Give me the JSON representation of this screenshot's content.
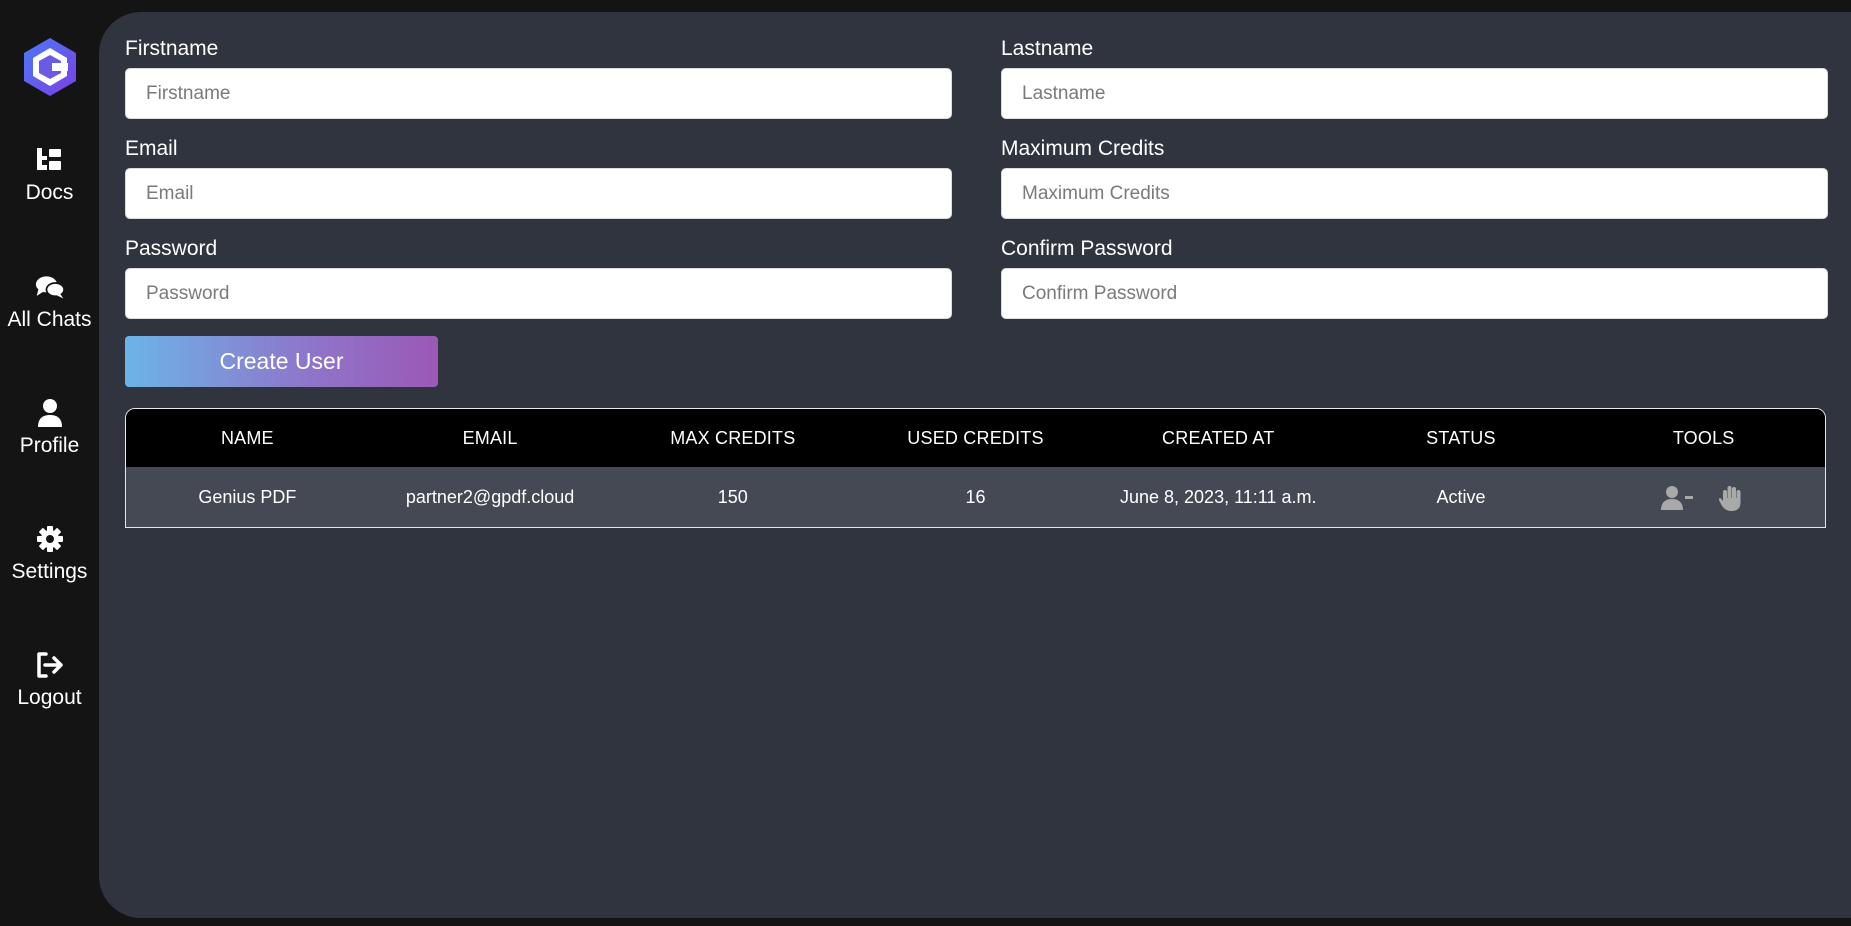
{
  "sidebar": {
    "logo_icon": "logo-icon",
    "items": [
      {
        "label": "Docs",
        "icon": "docs-icon"
      },
      {
        "label": "All Chats",
        "icon": "chats-icon"
      },
      {
        "label": "Profile",
        "icon": "user-icon"
      },
      {
        "label": "Settings",
        "icon": "gear-icon"
      },
      {
        "label": "Logout",
        "icon": "logout-icon"
      }
    ]
  },
  "form": {
    "firstname": {
      "label": "Firstname",
      "placeholder": "Firstname",
      "value": ""
    },
    "lastname": {
      "label": "Lastname",
      "placeholder": "Lastname",
      "value": ""
    },
    "email": {
      "label": "Email",
      "placeholder": "Email",
      "value": ""
    },
    "max_credits": {
      "label": "Maximum Credits",
      "placeholder": "Maximum Credits",
      "value": ""
    },
    "password": {
      "label": "Password",
      "placeholder": "Password",
      "value": ""
    },
    "confirm_password": {
      "label": "Confirm Password",
      "placeholder": "Confirm Password",
      "value": ""
    },
    "submit_label": "Create User"
  },
  "table": {
    "headers": [
      "NAME",
      "EMAIL",
      "MAX CREDITS",
      "USED CREDITS",
      "CREATED AT",
      "STATUS",
      "TOOLS"
    ],
    "rows": [
      {
        "name": "Genius PDF",
        "email": "partner2@gpdf.cloud",
        "max_credits": "150",
        "used_credits": "16",
        "created_at": "June 8, 2023, 11:11 a.m.",
        "status": "Active",
        "tools": [
          "remove-user-icon",
          "hand-stop-icon"
        ]
      }
    ]
  },
  "colors": {
    "sidebar_bg": "#141414",
    "main_bg": "#30343f",
    "table_header_bg": "#000000",
    "table_row_bg": "#454953",
    "button_gradient_start": "#6cb4e8",
    "button_gradient_end": "#9b59b6"
  }
}
